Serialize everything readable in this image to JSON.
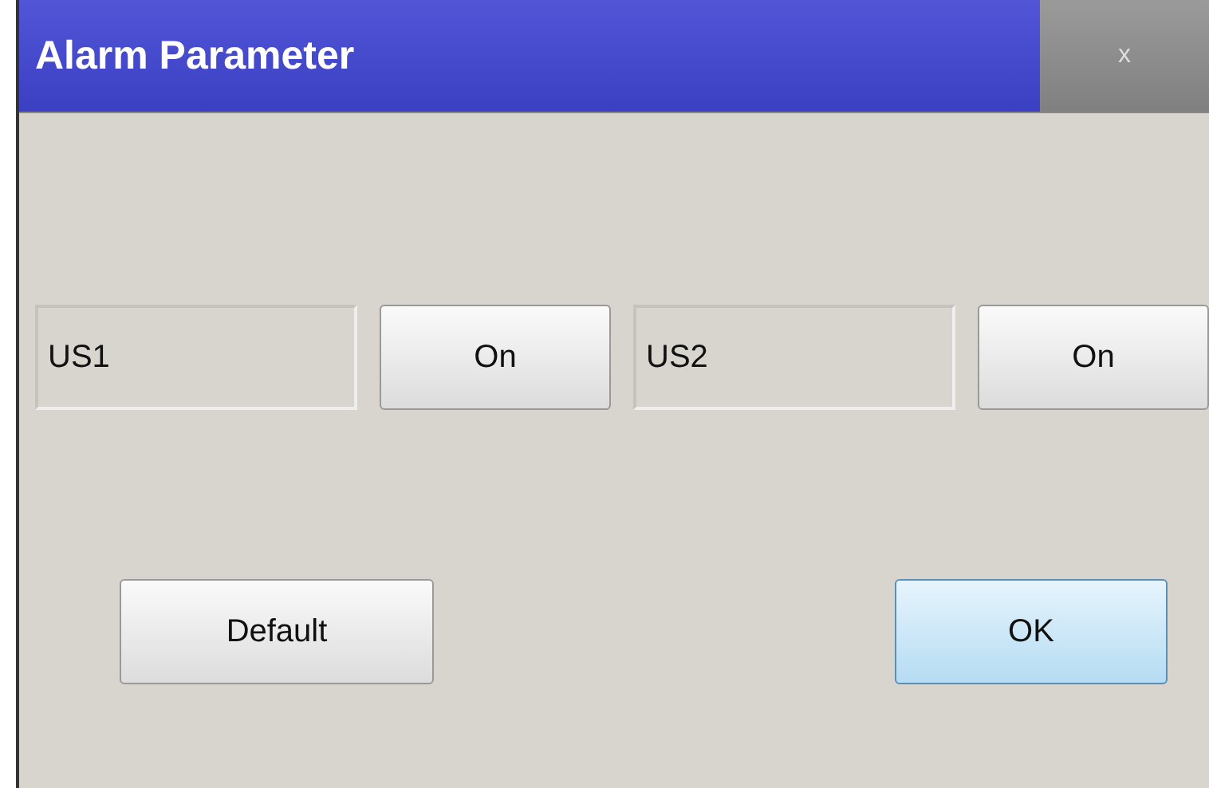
{
  "window": {
    "title": "Alarm Parameter",
    "close": "x"
  },
  "channels": [
    {
      "label": "US1",
      "button": "On"
    },
    {
      "label": "US2",
      "button": "On"
    }
  ],
  "buttons": [
    {
      "label": "Default",
      "highlighted": false
    },
    {
      "label": "OK",
      "highlighted": true
    }
  ]
}
